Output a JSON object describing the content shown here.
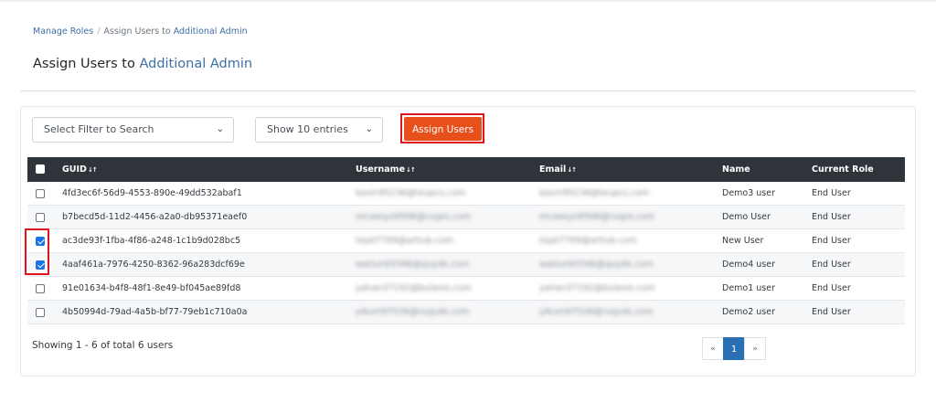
{
  "breadcrumb": {
    "parent": "Manage Roles",
    "separator": "/",
    "current_prefix": "Assign Users to ",
    "current_role": "Additional Admin"
  },
  "page_title": {
    "prefix": "Assign Users to ",
    "role": "Additional Admin"
  },
  "filters": {
    "search_filter": "Select Filter to Search",
    "entries": "Show 10 entries",
    "assign_button": "Assign Users"
  },
  "table": {
    "columns": {
      "guid": "GUID",
      "username": "Username",
      "email": "Email",
      "name": "Name",
      "role": "Current Role"
    },
    "rows": [
      {
        "checked": false,
        "guid": "4fd3ec6f-56d9-4553-890e-49dd532abaf1",
        "username": "kavin95236@teupcs.com",
        "email": "kavin95236@teupcs.com",
        "name": "Demo3 user",
        "role": "End User"
      },
      {
        "checked": false,
        "guid": "b7becd5d-11d2-4456-a2a0-db95371eaef0",
        "username": "mcseeyo9506@ruqos.com",
        "email": "mcseeyo9506@ruqos.com",
        "name": "Demo User",
        "role": "End User"
      },
      {
        "checked": true,
        "guid": "ac3de93f-1fba-4f86-a248-1c1b9d028bc5",
        "username": "tojat7709@artiub.com",
        "email": "tojat7709@artiub.com",
        "name": "New User",
        "role": "End User"
      },
      {
        "checked": true,
        "guid": "4aaf461a-7976-4250-8362-96a283dcf69e",
        "username": "watiun93346@quyde.com",
        "email": "watiun93346@quyde.com",
        "name": "Demo4 user",
        "role": "End User"
      },
      {
        "checked": false,
        "guid": "91e01634-b4f8-48f1-8e49-bf045ae89fd8",
        "username": "yahan37192@bulavio.com",
        "email": "yahan37192@bulavio.com",
        "name": "Demo1 user",
        "role": "End User"
      },
      {
        "checked": false,
        "guid": "4b50994d-79ad-4a5b-bf77-79eb1c710a0a",
        "username": "yikum97526@ruquds.com",
        "email": "yikum97526@ruquds.com",
        "name": "Demo2 user",
        "role": "End User"
      }
    ]
  },
  "footer": {
    "info": "Showing 1 - 6 of total 6 users",
    "pagination": {
      "prev": "«",
      "page": "1",
      "next": "»"
    }
  }
}
